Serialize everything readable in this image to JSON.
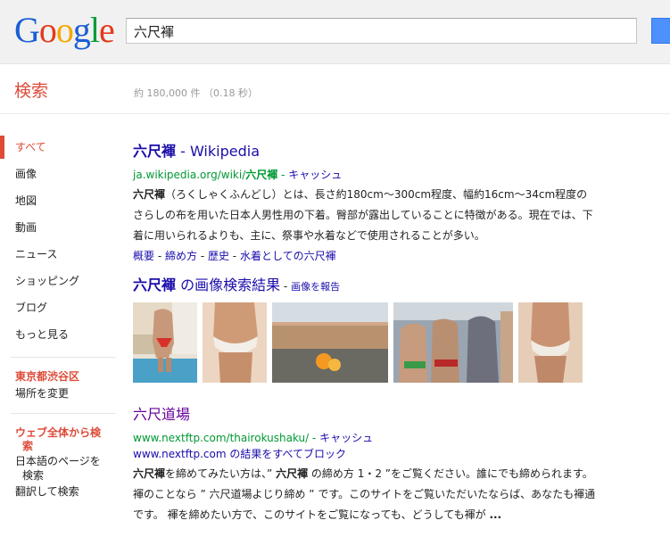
{
  "header": {
    "logo": [
      "G",
      "o",
      "o",
      "g",
      "l",
      "e"
    ],
    "logo_colors": [
      "#1a5ed3",
      "#e23b1c",
      "#f5a800",
      "#1a5ed3",
      "#0a9b3a",
      "#e23b1c"
    ],
    "query": "六尺褌"
  },
  "subheader": {
    "title": "検索",
    "stats": "約 180,000 件 （0.18 秒）"
  },
  "nav": {
    "items": [
      "すべて",
      "画像",
      "地図",
      "動画",
      "ニュース",
      "ショッピング",
      "ブログ",
      "もっと見る"
    ],
    "location_heading": "東京都渋谷区",
    "location_change": "場所を変更",
    "web_heading_line1": "ウェブ全体から検",
    "web_heading_line2": "索",
    "japanese_pages_line1": "日本語のページを",
    "japanese_pages_line2": "検索",
    "translate_search": "翻訳して検索"
  },
  "results": [
    {
      "title_hl": "六尺褌",
      "title_suffix": " - Wikipedia",
      "url_prefix": "ja.wikipedia.org/wiki/",
      "url_hl": "六尺褌",
      "url_sep": " - ",
      "cache": "キャッシュ",
      "snippet_hl": "六尺褌",
      "snippet_text": "（ろくしゃくふんどし）とは、長さ約180cm～300cm程度、幅約16cm～34cm程度のさらしの布を用いた日本人男性用の下着。臀部が露出していることに特徴がある。現在では、下着に用いられるよりも、主に、祭事や水着などで使用されることが多い。",
      "sitelinks": [
        "概要",
        "締め方",
        "歴史",
        "水着としての六尺褌"
      ],
      "sitelink_sep": " - "
    },
    {
      "title": "六尺道場",
      "url": "www.nextftp.com/thairokushaku/",
      "url_sep": " - ",
      "cache": "キャッシュ",
      "block_domain": "www.nextftp.com",
      "block_text": " の結果をすべてブロック",
      "snippet_parts": [
        {
          "t": "六尺褌",
          "b": true
        },
        {
          "t": "を締めてみたい方は、” ",
          "b": false
        },
        {
          "t": "六尺褌",
          "b": true
        },
        {
          "t": " の締め方 1・2 ”をご覧ください。誰にでも締められます。 褌のことなら ” 六尺道場よじり締め ” です。このサイトをご覧いただいたならば、あなたも褌通です。 褌を締めたい方で、このサイトをご覧になっても、どうしても褌が ",
          "b": false
        },
        {
          "t": "...",
          "b": true
        }
      ]
    }
  ],
  "images": {
    "title_hl": "六尺褌",
    "title_suffix": " の画像検索結果",
    "report_sep": " - ",
    "report": "画像を報告"
  }
}
